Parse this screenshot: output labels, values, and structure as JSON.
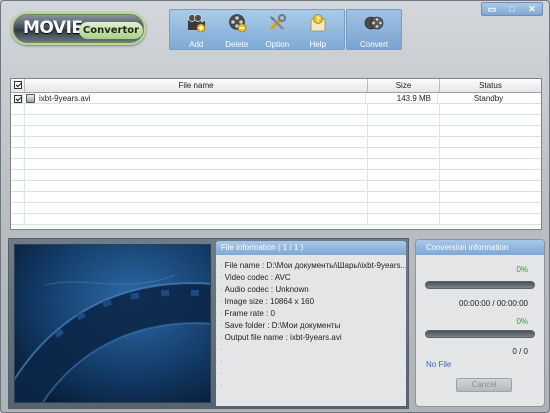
{
  "logo": {
    "word1": "MOVIE",
    "word2": "Convertor"
  },
  "toolbar": {
    "add_label": "Add",
    "delete_label": "Delete",
    "option_label": "Option",
    "help_label": "Help",
    "convert_label": "Convert"
  },
  "window_controls": {
    "minimize": "▭",
    "maximize": "□",
    "close": "✕"
  },
  "file_list": {
    "headers": {
      "name": "File name",
      "size": "Size",
      "status": "Status"
    },
    "rows": [
      {
        "checked": true,
        "name": "ixbt-9years.avi",
        "size": "143.9 MB",
        "status": "Standby"
      }
    ]
  },
  "file_info": {
    "title": "File information ( 1 / 1 )",
    "lines": [
      "File name :  D:\\Мои документы\\Шары\\ixbt-9years....",
      "Video codec :  AVC",
      "Audio codec :  Unknown",
      "Image size : 10864 x 160",
      "Frame rate : 0",
      "Save folder :  D:\\Мои документы",
      "Output file name :  ixbt-9years.avi"
    ]
  },
  "conversion": {
    "title": "Conversion information",
    "percent1": "0%",
    "progress1": 0,
    "time": "00:00:00 / 00:00:00",
    "percent2": "0%",
    "progress2": 0,
    "count": "0 / 0",
    "status": "No File",
    "cancel_label": "Cancel"
  },
  "colors": {
    "accent": "#7ea8d4",
    "progress_text": "#3d9a2c",
    "status_text": "#3a67b3"
  }
}
